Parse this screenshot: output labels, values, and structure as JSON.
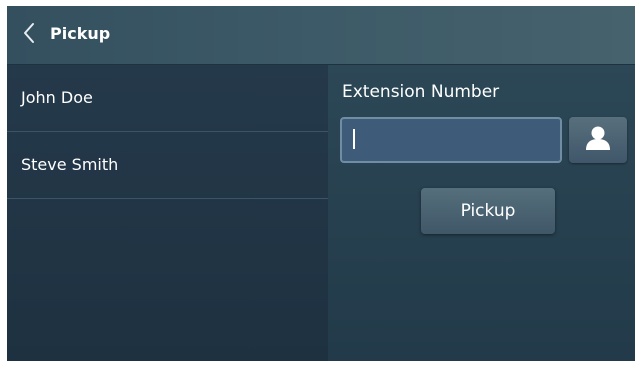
{
  "header": {
    "back_icon": "chevron-left-icon",
    "title": "Pickup"
  },
  "contacts": [
    {
      "name": "John Doe"
    },
    {
      "name": "Steve Smith"
    }
  ],
  "pickup_form": {
    "label": "Extension Number",
    "input_value": "",
    "contact_icon": "person-icon",
    "button_label": "Pickup"
  },
  "colors": {
    "header_bg": "#3d5a68",
    "panel_bg": "#223847",
    "input_bg": "#3f5b7a",
    "input_border": "#6f8ea4",
    "button_bg": "#4b6372",
    "text": "#ffffff"
  }
}
